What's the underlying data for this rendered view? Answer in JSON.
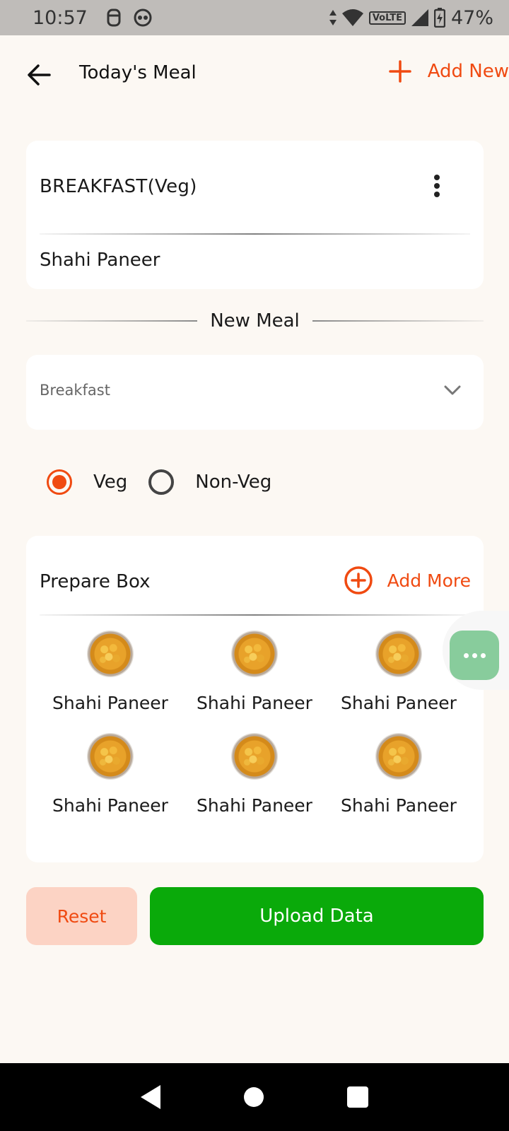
{
  "status_bar": {
    "time": "10:57",
    "volte": "VoLTE",
    "battery": "47%"
  },
  "header": {
    "title": "Today's Meal",
    "add_new_label": "Add New"
  },
  "meal_card": {
    "title": "BREAKFAST(Veg)",
    "item": "Shahi Paneer"
  },
  "separator_label": "New Meal",
  "meal_type_select": {
    "value": "Breakfast"
  },
  "diet_options": [
    {
      "label": "Veg",
      "selected": true
    },
    {
      "label": "Non-Veg",
      "selected": false
    }
  ],
  "prepare_box": {
    "title": "Prepare Box",
    "add_more_label": "Add More",
    "items": [
      {
        "name": "Shahi Paneer"
      },
      {
        "name": "Shahi Paneer"
      },
      {
        "name": "Shahi Paneer"
      },
      {
        "name": "Shahi Paneer"
      },
      {
        "name": "Shahi Paneer"
      },
      {
        "name": "Shahi Paneer"
      }
    ]
  },
  "buttons": {
    "reset": "Reset",
    "upload": "Upload Data"
  },
  "colors": {
    "accent": "#f04a11",
    "upload_green": "#0aaa0a",
    "chat_green": "#88cc9c",
    "background": "#fcf8f3"
  }
}
